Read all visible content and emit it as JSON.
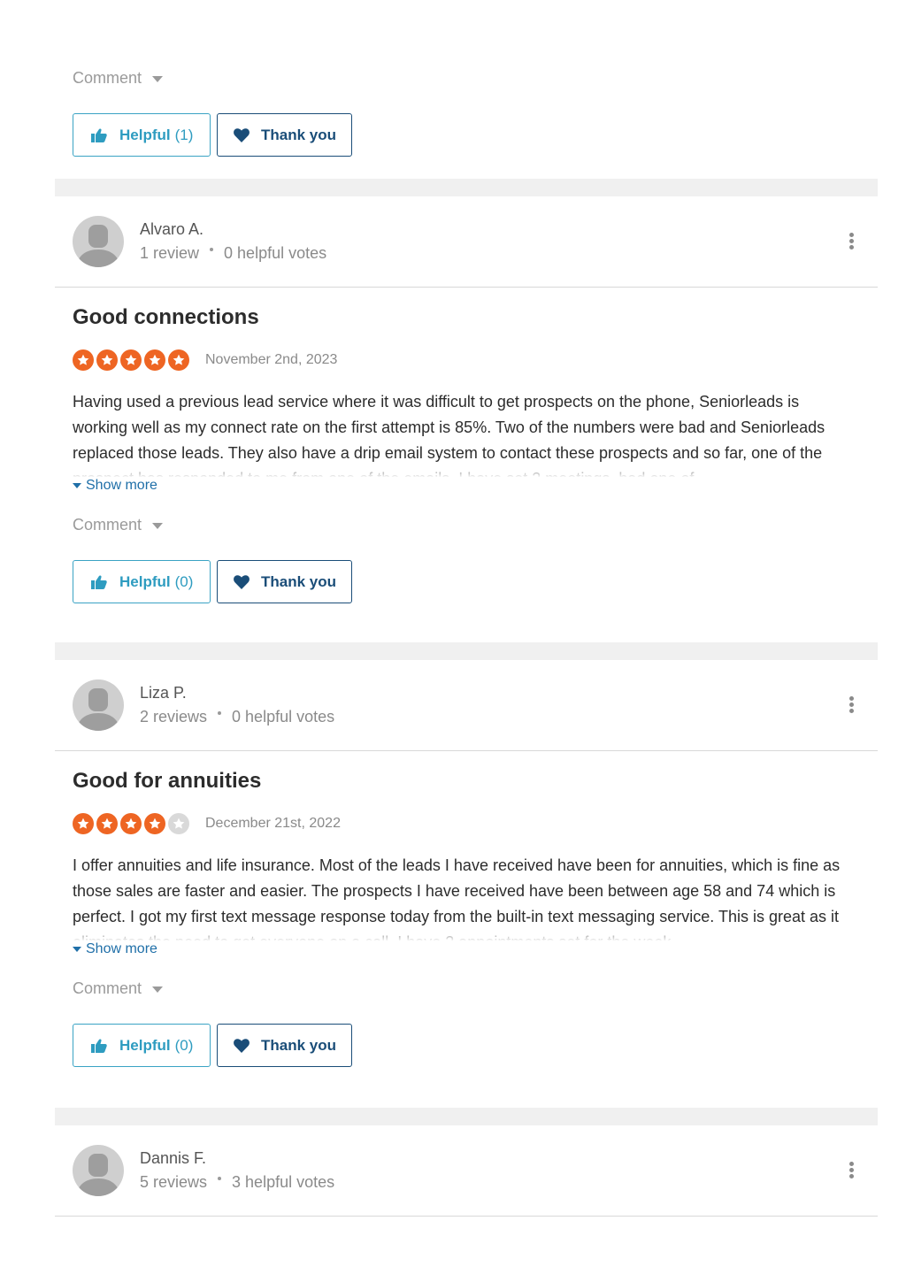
{
  "top_card": {
    "comment_label": "Comment",
    "helpful_label": "Helpful",
    "helpful_count": "(1)",
    "thanks_label": "Thank you"
  },
  "reviews": [
    {
      "name": "Alvaro A.",
      "review_count": "1 review",
      "helpful_votes": "0 helpful votes",
      "title": "Good connections",
      "rating": 5,
      "date": "November 2nd, 2023",
      "text": "Having used a previous lead service where it was difficult to get prospects on the phone, Seniorleads is working well as my connect rate on the first attempt is 85%. Two of the numbers were bad and Seniorleads replaced those leads. They also have a drip email system to contact these prospects and so far, one of the prospect has responded to me from one of the emails. I have set 2 meetings, had one of",
      "show_more": "Show more",
      "comment_label": "Comment",
      "helpful_label": "Helpful",
      "helpful_count": "(0)",
      "thanks_label": "Thank you"
    },
    {
      "name": "Liza P.",
      "review_count": "2 reviews",
      "helpful_votes": "0 helpful votes",
      "title": "Good for annuities",
      "rating": 4,
      "date": "December 21st, 2022",
      "text": "I offer annuities and life insurance. Most of the leads I have received have been for annuities, which is fine as those sales are faster and easier. The prospects I have received have been between age 58 and 74 which is perfect. I got my first text message response today from the built-in text messaging service. This is great as it eliminates the need to get everyone on a call. I have 2 appointments set for the week",
      "show_more": "Show more",
      "comment_label": "Comment",
      "helpful_label": "Helpful",
      "helpful_count": "(0)",
      "thanks_label": "Thank you"
    },
    {
      "name": "Dannis F.",
      "review_count": "5 reviews",
      "helpful_votes": "3 helpful votes"
    }
  ],
  "colors": {
    "star_on": "#ee6523",
    "star_off": "#d9d9d9",
    "helpful_accent": "#2e9cc0",
    "thanks_accent": "#1a4d78",
    "link": "#1f6fa8"
  },
  "icons": {
    "helpful": "thumbs-up-icon",
    "thanks": "heart-icon",
    "menu": "kebab-menu-icon",
    "avatar": "user-placeholder-icon",
    "star": "star-icon"
  }
}
